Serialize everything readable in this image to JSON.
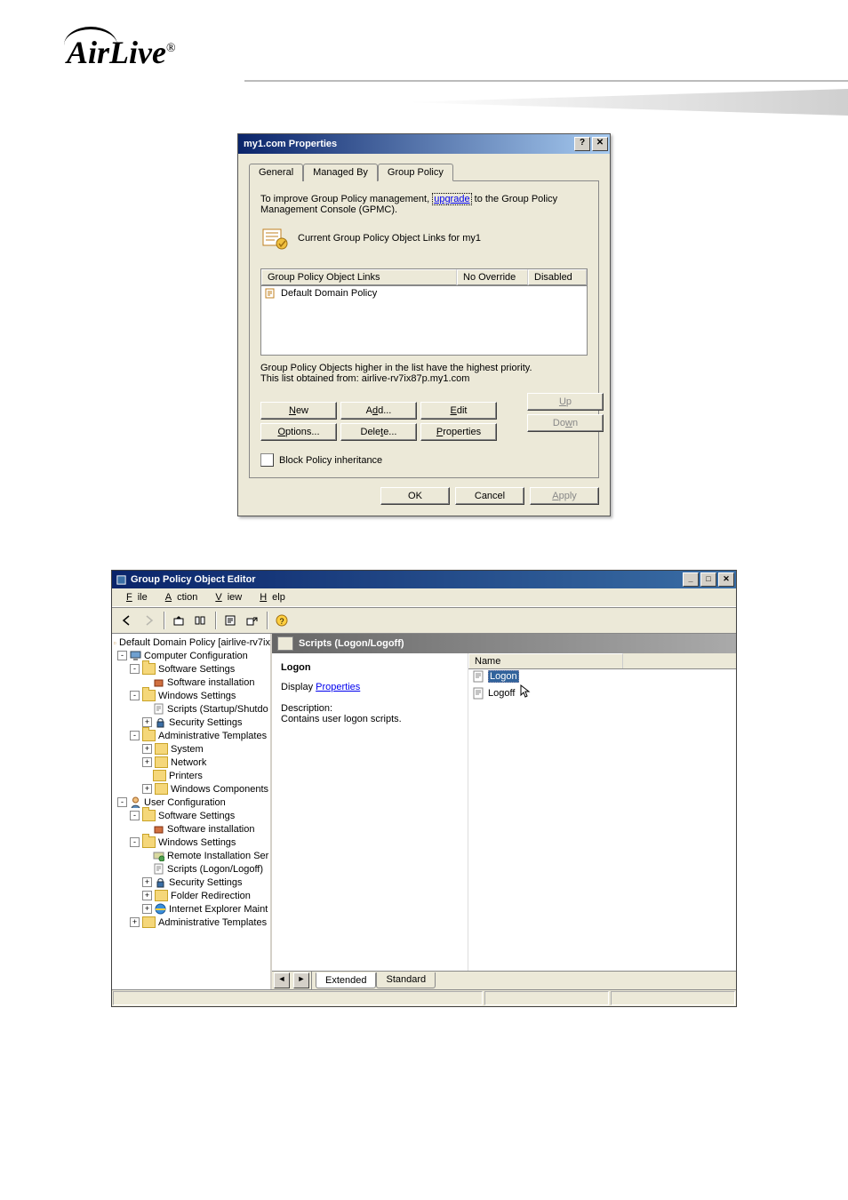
{
  "brand": {
    "name": "AirLive",
    "reg": "®"
  },
  "dialog1": {
    "title": "my1.com Properties",
    "tabs": {
      "general": "General",
      "managedBy": "Managed By",
      "groupPolicy": "Group Policy"
    },
    "intro_a": "To improve Group Policy management, ",
    "intro_link": "upgrade",
    "intro_b": " to the Group Policy Management Console (GPMC).",
    "iconRowText": "Current Group Policy Object Links for my1",
    "list": {
      "col1": "Group Policy Object Links",
      "col2": "No Override",
      "col3": "Disabled",
      "row1": "Default Domain Policy"
    },
    "note1": "Group Policy Objects higher in the list have the highest priority.",
    "note2": "This list obtained from: airlive-rv7ix87p.my1.com",
    "buttons": {
      "new": "New",
      "add": "Add...",
      "edit": "Edit",
      "options": "Options...",
      "delete": "Delete...",
      "properties": "Properties",
      "up": "Up",
      "down": "Down"
    },
    "checkbox": "Block Policy inheritance",
    "actions": {
      "ok": "OK",
      "cancel": "Cancel",
      "apply": "Apply"
    }
  },
  "window2": {
    "title": "Group Policy Object Editor",
    "menu": {
      "file": "File",
      "action": "Action",
      "view": "View",
      "help": "Help"
    },
    "tree": {
      "root": "Default Domain Policy [airlive-rv7ix",
      "compConfig": "Computer Configuration",
      "cc_sw": "Software Settings",
      "cc_sw_inst": "Software installation",
      "cc_win": "Windows Settings",
      "cc_win_scripts": "Scripts (Startup/Shutdo",
      "cc_win_sec": "Security Settings",
      "cc_admin": "Administrative Templates",
      "cc_admin_sys": "System",
      "cc_admin_net": "Network",
      "cc_admin_prn": "Printers",
      "cc_admin_wc": "Windows Components",
      "userConfig": "User Configuration",
      "uc_sw": "Software Settings",
      "uc_sw_inst": "Software installation",
      "uc_win": "Windows Settings",
      "uc_win_ris": "Remote Installation Ser",
      "uc_win_scripts": "Scripts (Logon/Logoff)",
      "uc_win_sec": "Security Settings",
      "uc_win_folder": "Folder Redirection",
      "uc_win_ie": "Internet Explorer Maint",
      "uc_admin": "Administrative Templates"
    },
    "header": "Scripts (Logon/Logoff)",
    "desc": {
      "title": "Logon",
      "displayLabel": "Display ",
      "displayLink": "Properties",
      "descLabel": "Description:",
      "descText": "Contains user logon scripts."
    },
    "list": {
      "colName": "Name",
      "item1": "Logon",
      "item2": "Logoff"
    },
    "bottomTabs": {
      "extended": "Extended",
      "standard": "Standard"
    }
  }
}
